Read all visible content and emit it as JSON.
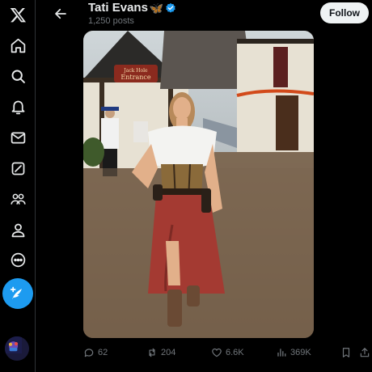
{
  "header": {
    "name": "Tati Evans",
    "name_emoji": "🦋",
    "post_count": "1,250 posts",
    "follow_label": "Follow"
  },
  "nav": {
    "items": [
      "x-logo-icon",
      "home-icon",
      "explore-icon",
      "notifications-icon",
      "messages-icon",
      "grok-icon",
      "communities-icon",
      "profile-icon",
      "more-icon"
    ]
  },
  "media": {
    "sign_text_line1": "Jack Hole",
    "sign_text_line2": "Entrance"
  },
  "actions": {
    "replies": "62",
    "reposts": "204",
    "likes": "6.6K",
    "views": "369K"
  },
  "colors": {
    "accent": "#1d9bf0",
    "background": "#000000",
    "text": "#e7e9ea",
    "muted": "#71767b"
  }
}
